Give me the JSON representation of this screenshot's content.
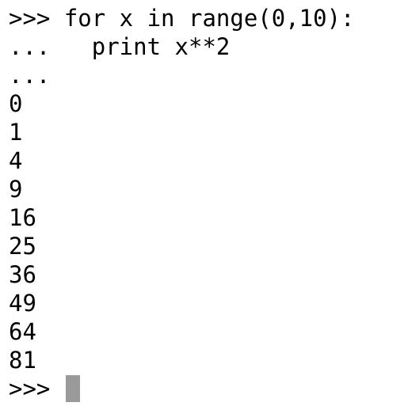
{
  "terminal": {
    "lines": [
      {
        "prompt": ">>> ",
        "code": "for x in range(0,10):"
      },
      {
        "prompt": "...   ",
        "code": "print x**2"
      },
      {
        "prompt": "...",
        "code": ""
      },
      {
        "prompt": "",
        "code": "0"
      },
      {
        "prompt": "",
        "code": "1"
      },
      {
        "prompt": "",
        "code": "4"
      },
      {
        "prompt": "",
        "code": "9"
      },
      {
        "prompt": "",
        "code": "16"
      },
      {
        "prompt": "",
        "code": "25"
      },
      {
        "prompt": "",
        "code": "36"
      },
      {
        "prompt": "",
        "code": "49"
      },
      {
        "prompt": "",
        "code": "64"
      },
      {
        "prompt": "",
        "code": "81"
      }
    ],
    "current_prompt": ">>> ",
    "cursor_color": "#9a9a9a",
    "background_color": "#ffffff",
    "text_color": "#000000"
  }
}
